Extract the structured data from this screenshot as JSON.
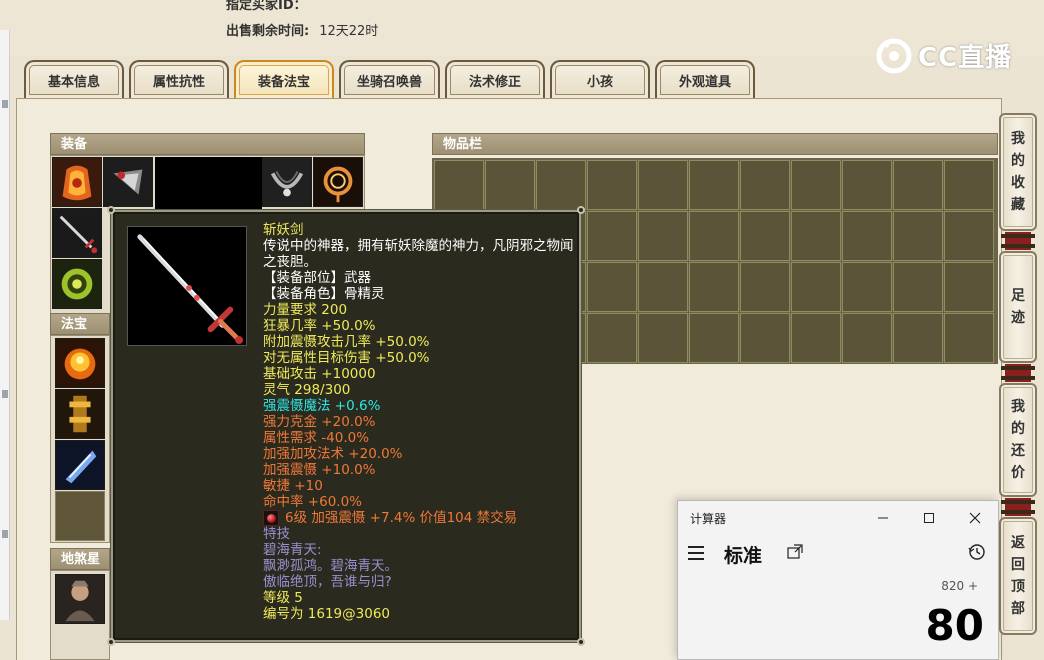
{
  "header": {
    "row1_label": "指定买家ID：",
    "sale_time_label": "出售剩余时间:",
    "sale_time_value": "12天22时"
  },
  "logo": {
    "text": "CC直播",
    "icon": "cc-logo-icon"
  },
  "tabs": [
    {
      "label": "基本信息"
    },
    {
      "label": "属性抗性"
    },
    {
      "label": "装备法宝",
      "active": true
    },
    {
      "label": "坐骑召唤兽"
    },
    {
      "label": "法术修正"
    },
    {
      "label": "小孩"
    },
    {
      "label": "外观道具"
    }
  ],
  "sections": {
    "equipment": "装备",
    "fabao": "法宝",
    "star": "地煞星",
    "inventory": "物品栏"
  },
  "tooltip": {
    "name": "斩妖剑",
    "description": "传说中的神器，拥有斩妖除魔的神力，凡阴邪之物闻之丧胆。",
    "slot": "【装备部位】武器",
    "role": "【装备角色】骨精灵",
    "stats_yellow": [
      "力量要求 200",
      "狂暴几率 +50.0%",
      "附加震慑攻击几率 +50.0%",
      "对无属性目标伤害 +50.0%",
      "基础攻击 +10000",
      "灵气 298/300"
    ],
    "stat_cyan": "强震慑魔法 +0.6%",
    "stats_orange": [
      "强力克金 +20.0%",
      "属性需求 -40.0%",
      "加强加攻法术 +20.0%",
      "加强震慑 +10.0%",
      "敏捷 +10",
      "命中率 +60.0%"
    ],
    "gem_line": "6级 加强震慑 +7.4% 价值104 禁交易",
    "skill_title": "特技",
    "skill_lines": [
      "碧海青天:",
      "飘渺孤鸿。碧海青天。",
      "傲临绝顶，吾谁与归?"
    ],
    "level": "等级 5",
    "serial": "编号为 1619@3060"
  },
  "side_buttons": [
    {
      "label": [
        "我",
        "的",
        "收",
        "藏"
      ]
    },
    {
      "label": [
        "足",
        "迹"
      ]
    },
    {
      "label": [
        "我",
        "的",
        "还",
        "价"
      ]
    },
    {
      "label": [
        "返",
        "回",
        "顶",
        "部"
      ]
    }
  ],
  "calculator": {
    "title": "计算器",
    "mode": "标准",
    "expression": "820 +",
    "value": "80",
    "controls": [
      "minimize-icon",
      "maximize-icon",
      "close-icon"
    ]
  },
  "colors": {
    "tooltip_bg": "#2a2a1e",
    "yellow_text": "#f0ea5a",
    "cyan_text": "#2ee6e6",
    "orange_text": "#f07838",
    "purple_text": "#9c8ed0",
    "active_tab_border": "#c88a1e"
  }
}
